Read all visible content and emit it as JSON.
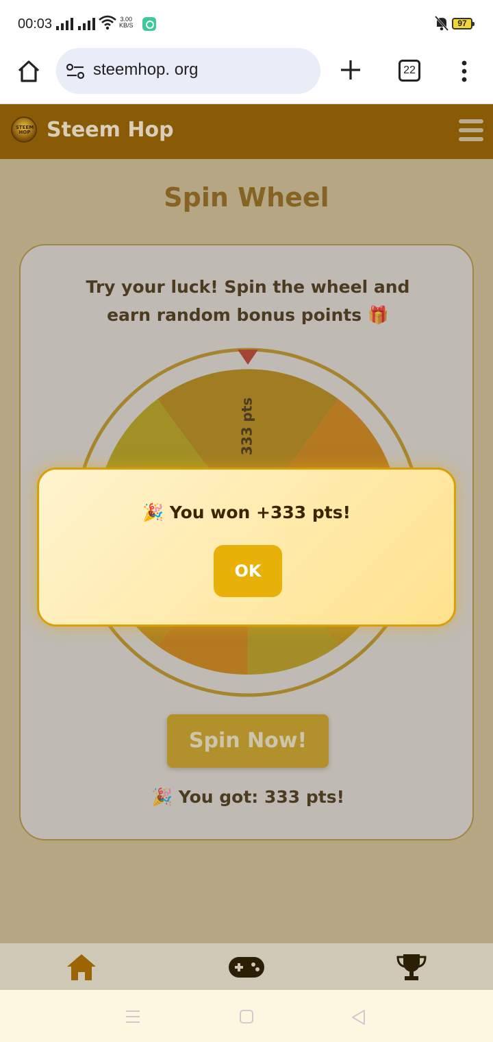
{
  "status_bar": {
    "time": "00:03",
    "net_speed_value": "3.00",
    "net_speed_unit": "KB/S",
    "battery": "97"
  },
  "browser": {
    "url": "steemhop. org",
    "tab_count": "22"
  },
  "site": {
    "logo_text": "STEEM HOP",
    "title": "Steem Hop"
  },
  "page": {
    "title": "Spin Wheel",
    "intro": "Try your luck! Spin the wheel and earn random bonus points 🎁",
    "wheel_top_label": "333 pts",
    "spin_button": "Spin Now!",
    "result": "🎉 You got: 333 pts!"
  },
  "modal": {
    "message": "🎉 You won +333 pts!",
    "ok_button": "OK"
  },
  "bottom_nav": {
    "items": [
      "home-icon",
      "gamepad-icon",
      "trophy-icon"
    ]
  },
  "colors": {
    "header": "#8a5b06",
    "accent": "#e8b10a",
    "title": "#8d5a04"
  }
}
